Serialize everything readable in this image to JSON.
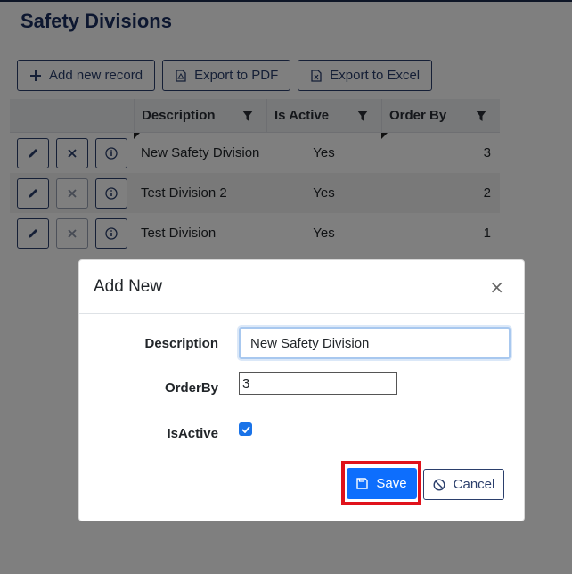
{
  "page": {
    "title": "Safety Divisions"
  },
  "toolbar": {
    "add_label": "Add new record",
    "pdf_label": "Export to PDF",
    "excel_label": "Export to Excel"
  },
  "grid": {
    "columns": [
      "Description",
      "Is Active",
      "Order By"
    ],
    "rows": [
      {
        "description": "New Safety Division",
        "is_active": "Yes",
        "order_by": "3"
      },
      {
        "description": "Test Division 2",
        "is_active": "Yes",
        "order_by": "2"
      },
      {
        "description": "Test Division",
        "is_active": "Yes",
        "order_by": "1"
      }
    ]
  },
  "dialog": {
    "title": "Add New",
    "close_glyph": "×",
    "description_label": "Description",
    "description_value": "New Safety Division",
    "orderby_label": "OrderBy",
    "orderby_value": "3",
    "isactive_label": "IsActive",
    "isactive_checked": true,
    "save_label": "Save",
    "cancel_label": "Cancel"
  },
  "colors": {
    "primary": "#0d6efd",
    "navy": "#1b2f60",
    "highlight": "#e0121b",
    "overlay": "rgba(0,0,0,0.5)"
  }
}
